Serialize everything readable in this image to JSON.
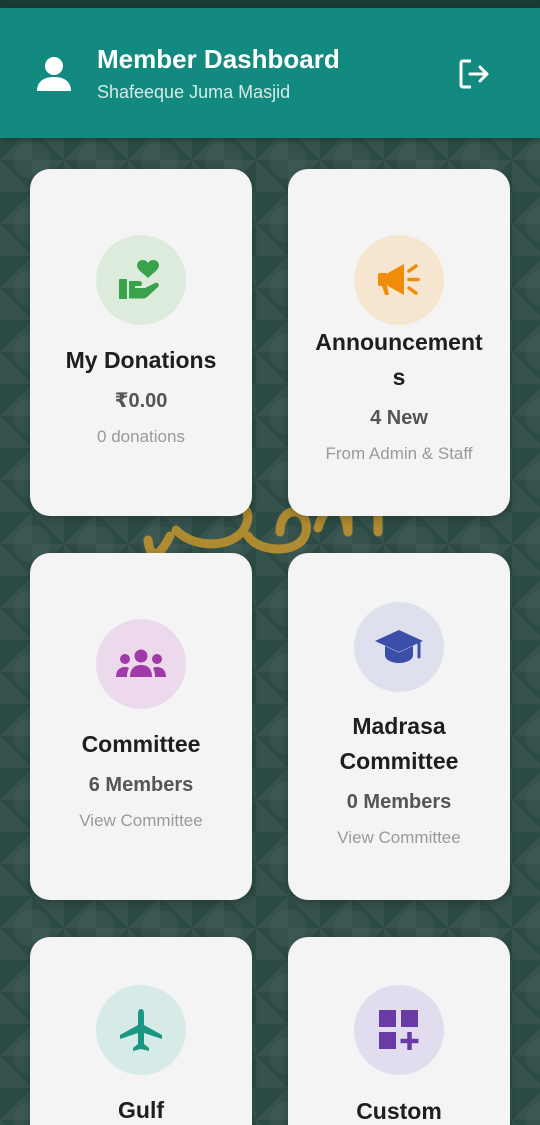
{
  "header": {
    "title": "Member Dashboard",
    "subtitle": "Shafeeque Juma Masjid",
    "avatar_icon": "person-icon",
    "logout_icon": "logout-icon",
    "color": "#138a80"
  },
  "watermark_text": "البشارة",
  "cards": [
    {
      "label": "My Donations",
      "value": "₹0.00",
      "sub": "0 donations",
      "icon": "donation-hand-heart-icon",
      "icon_color": "#3aa24a",
      "circle_color": "#dcebdc"
    },
    {
      "label_line1": "Announcement",
      "label_line2": "s",
      "value": "4 New",
      "sub": "From Admin & Staff",
      "icon": "megaphone-icon",
      "icon_color": "#f08c0a",
      "circle_color": "#f7e6cf"
    },
    {
      "label": "Committee",
      "value": "6 Members",
      "sub": "View Committee",
      "icon": "group-icon",
      "icon_color": "#a03aa8",
      "circle_color": "#ecd9ec"
    },
    {
      "label_line1": "Madrasa",
      "label_line2": "Committee",
      "value": "0 Members",
      "sub": "View Committee",
      "icon": "graduation-cap-icon",
      "icon_color": "#3b4fa8",
      "circle_color": "#dfe0ee"
    },
    {
      "label": "Gulf",
      "icon": "airplane-icon",
      "icon_color": "#1a9684",
      "circle_color": "#d6ebe7"
    },
    {
      "label": "Custom",
      "icon": "dashboard-add-icon",
      "icon_color": "#6a3aa6",
      "circle_color": "#e2dcef"
    }
  ]
}
